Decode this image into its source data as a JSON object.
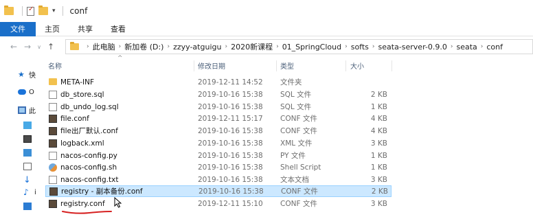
{
  "window": {
    "title": "conf"
  },
  "ribbon": {
    "tabs": [
      "文件",
      "主页",
      "共享",
      "查看"
    ]
  },
  "address": {
    "crumbs": [
      "此电脑",
      "新加卷 (D:)",
      "zzyy-atguigu",
      "2020新课程",
      "01_SpringCloud",
      "softs",
      "seata-server-0.9.0",
      "seata",
      "conf"
    ]
  },
  "nav_pane": {
    "items": [
      {
        "label": "快",
        "icon": "star-icon"
      },
      {
        "label": "O",
        "icon": "cloud-icon"
      },
      {
        "label": "此",
        "icon": "computer-icon"
      },
      {
        "label": "",
        "icon": "3d-objects-icon"
      },
      {
        "label": "",
        "icon": "video-icon"
      },
      {
        "label": "",
        "icon": "documents-icon"
      },
      {
        "label": "",
        "icon": "downloads-icon"
      },
      {
        "label": "i",
        "icon": "music-icon"
      },
      {
        "label": "",
        "icon": "desktop-icon"
      }
    ]
  },
  "columns": {
    "name": "名称",
    "modified": "修改日期",
    "type": "类型",
    "size": "大小"
  },
  "files": [
    {
      "name": "META-INF",
      "date": "2019-12-11 14:52",
      "type": "文件夹",
      "size": "",
      "icon": "folder-icon"
    },
    {
      "name": "db_store.sql",
      "date": "2019-10-16 15:38",
      "type": "SQL 文件",
      "size": "2 KB",
      "icon": "document-icon"
    },
    {
      "name": "db_undo_log.sql",
      "date": "2019-10-16 15:38",
      "type": "SQL 文件",
      "size": "1 KB",
      "icon": "document-icon"
    },
    {
      "name": "file.conf",
      "date": "2019-12-11 15:17",
      "type": "CONF 文件",
      "size": "4 KB",
      "icon": "conf-file-icon"
    },
    {
      "name": "file出厂默认.conf",
      "date": "2019-10-16 15:38",
      "type": "CONF 文件",
      "size": "4 KB",
      "icon": "conf-file-icon"
    },
    {
      "name": "logback.xml",
      "date": "2019-10-16 15:38",
      "type": "XML 文件",
      "size": "3 KB",
      "icon": "conf-file-icon"
    },
    {
      "name": "nacos-config.py",
      "date": "2019-10-16 15:38",
      "type": "PY 文件",
      "size": "1 KB",
      "icon": "document-icon"
    },
    {
      "name": "nacos-config.sh",
      "date": "2019-10-16 15:38",
      "type": "Shell Script",
      "size": "1 KB",
      "icon": "shell-script-icon"
    },
    {
      "name": "nacos-config.txt",
      "date": "2019-10-16 15:38",
      "type": "文本文档",
      "size": "3 KB",
      "icon": "document-icon"
    },
    {
      "name": "registry - 副本备份.conf",
      "date": "2019-10-16 15:38",
      "type": "CONF 文件",
      "size": "2 KB",
      "icon": "conf-file-icon",
      "selected": true
    },
    {
      "name": "registry.conf",
      "date": "2019-12-11 15:10",
      "type": "CONF 文件",
      "size": "3 KB",
      "icon": "conf-file-icon"
    }
  ],
  "colors": {
    "file_tab": "#1a6fc9",
    "selection": "#cce8ff",
    "annotation": "#d62020"
  }
}
